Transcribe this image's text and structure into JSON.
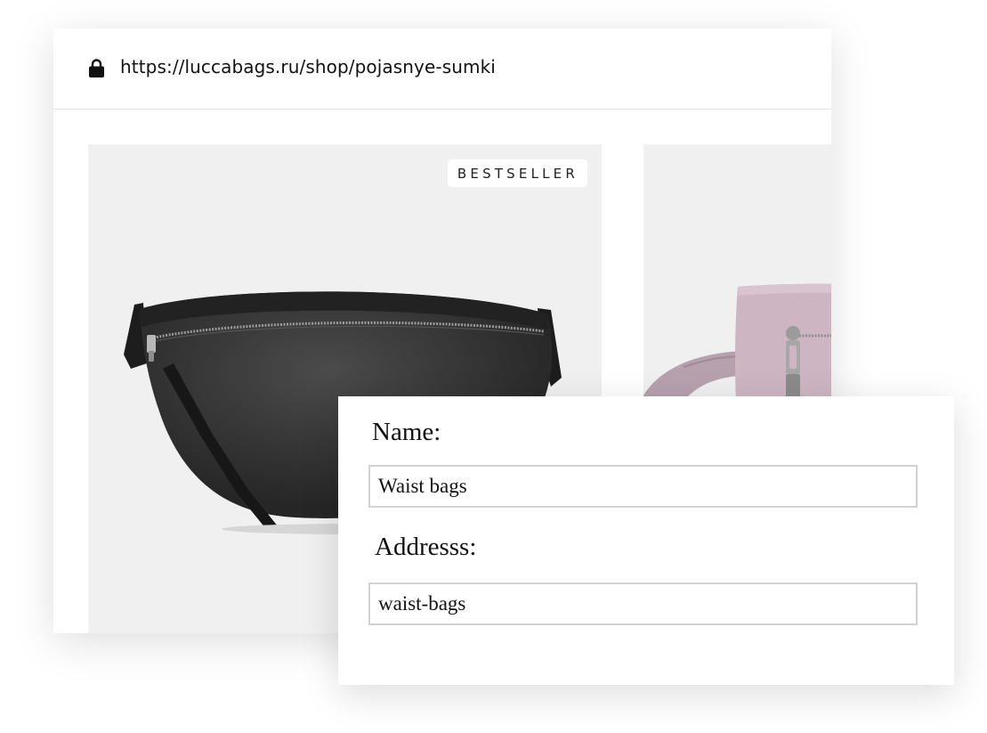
{
  "browser": {
    "url": "https://luccabags.ru/shop/pojasnye-sumki",
    "lock_icon": "lock-icon"
  },
  "products": [
    {
      "badge": "BESTSELLER",
      "image": "black-leather-waist-bag",
      "background": "#f0f0f0"
    },
    {
      "image": "pink-leather-waist-bag",
      "background": "#f0f0f0"
    }
  ],
  "form": {
    "name_label": "Name:",
    "name_value": "Waist bags",
    "address_label": "Addresss:",
    "address_value": "waist-bags"
  },
  "colors": {
    "bag_black": "#2b2b2b",
    "bag_pink": "#cdb6c2",
    "input_border": "#d2d2d2",
    "card_bg": "#f0f0f0"
  }
}
